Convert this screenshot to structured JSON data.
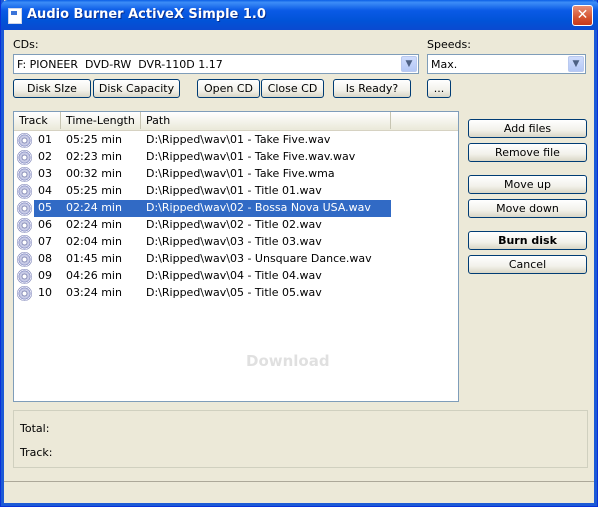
{
  "window": {
    "title": "Audio Burner ActiveX Simple 1.0",
    "close_glyph": "✕"
  },
  "cds": {
    "label": "CDs:",
    "selected": "F: PIONEER  DVD-RW  DVR-110D 1.17"
  },
  "speeds": {
    "label": "Speeds:",
    "selected": "Max."
  },
  "toolbar": {
    "disk_size": "Disk SIze",
    "disk_capacity": "Disk Capacity",
    "open_cd": "Open CD",
    "close_cd": "Close CD",
    "is_ready": "Is Ready?",
    "more": "..."
  },
  "list": {
    "columns": {
      "track": "Track",
      "time": "Time-Length",
      "path": "Path"
    },
    "rows": [
      {
        "track": "01",
        "time": "05:25 min",
        "path": "D:\\Ripped\\wav\\01 - Take Five.wav"
      },
      {
        "track": "02",
        "time": "02:23 min",
        "path": "D:\\Ripped\\wav\\01 - Take Five.wav.wav"
      },
      {
        "track": "03",
        "time": "00:32 min",
        "path": "D:\\Ripped\\wav\\01 - Take Five.wma"
      },
      {
        "track": "04",
        "time": "05:25 min",
        "path": "D:\\Ripped\\wav\\01 - Title 01.wav"
      },
      {
        "track": "05",
        "time": "02:24 min",
        "path": "D:\\Ripped\\wav\\02 - Bossa Nova USA.wav"
      },
      {
        "track": "06",
        "time": "02:24 min",
        "path": "D:\\Ripped\\wav\\02 - Title 02.wav"
      },
      {
        "track": "07",
        "time": "02:04 min",
        "path": "D:\\Ripped\\wav\\03 - Title 03.wav"
      },
      {
        "track": "08",
        "time": "01:45 min",
        "path": "D:\\Ripped\\wav\\03 - Unsquare Dance.wav"
      },
      {
        "track": "09",
        "time": "04:26 min",
        "path": "D:\\Ripped\\wav\\04 - Title 04.wav"
      },
      {
        "track": "10",
        "time": "03:24 min",
        "path": "D:\\Ripped\\wav\\05 - Title 05.wav"
      }
    ],
    "selected_track": "05"
  },
  "actions": {
    "add_files": "Add files",
    "remove_file": "Remove file",
    "move_up": "Move up",
    "move_down": "Move down",
    "burn_disk": "Burn disk",
    "cancel": "Cancel"
  },
  "info": {
    "total_label": "Total:",
    "track_label": "Track:"
  },
  "watermark": "Download"
}
